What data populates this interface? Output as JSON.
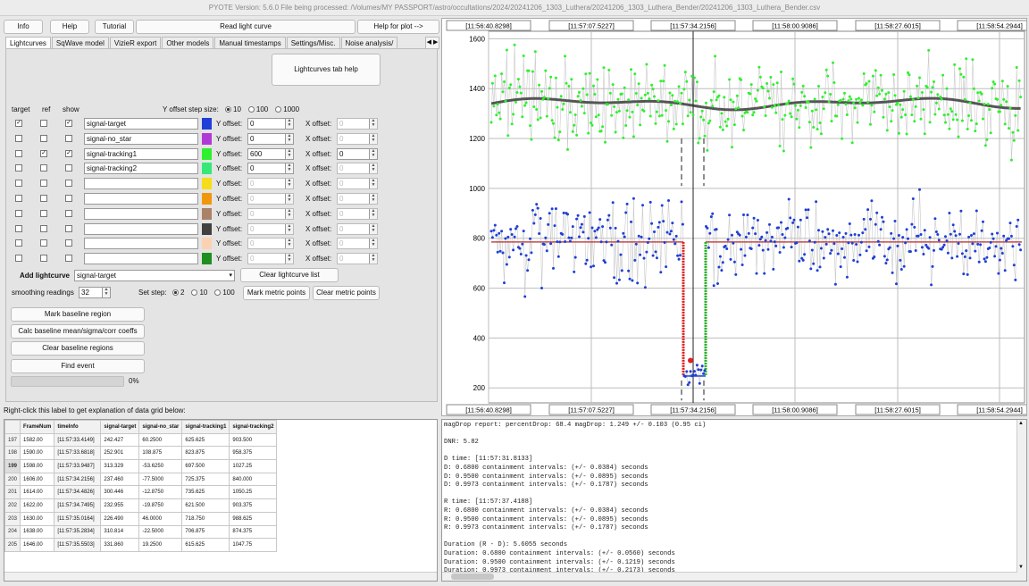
{
  "window": {
    "title": "PYOTE Version: 5.6.0  File being processed: /Volumes/MY PASSPORT/astro/occultations/2024/20241206_1303_Luthera/20241206_1303_Luthera_Bender/20241206_1303_Luthera_Bender.csv"
  },
  "toolbar": {
    "info": "Info",
    "help": "Help",
    "tutorial": "Tutorial",
    "read_light_curve": "Read light curve",
    "help_plot": "Help for plot -->"
  },
  "tabs": [
    {
      "label": "Lightcurves",
      "active": true
    },
    {
      "label": "SqWave model"
    },
    {
      "label": "VizieR export"
    },
    {
      "label": "Other models"
    },
    {
      "label": "Manual timestamps"
    },
    {
      "label": "Settings/Misc."
    },
    {
      "label": "Noise analysis/"
    }
  ],
  "lc_tab_help": "Lightcurves tab help",
  "col_headers": {
    "target": "target",
    "ref": "ref",
    "show": "show"
  },
  "y_offset_step": {
    "label": "Y offset step size:",
    "options": [
      "10",
      "100",
      "1000"
    ],
    "selected": "10"
  },
  "y_offset_label": "Y offset:",
  "x_offset_label": "X offset:",
  "curves": [
    {
      "name": "signal-target",
      "target": true,
      "ref": false,
      "show": true,
      "color": "#1f3fd6",
      "yoff": "0",
      "xoff": "0",
      "enabled": true,
      "xoff_enabled": false
    },
    {
      "name": "signal-no_star",
      "target": false,
      "ref": false,
      "show": false,
      "color": "#b03ad6",
      "yoff": "0",
      "xoff": "0",
      "enabled": true,
      "xoff_enabled": false
    },
    {
      "name": "signal-tracking1",
      "target": false,
      "ref": true,
      "show": true,
      "color": "#2ff02f",
      "yoff": "600",
      "xoff": "0",
      "enabled": true,
      "xoff_enabled": true
    },
    {
      "name": "signal-tracking2",
      "target": false,
      "ref": false,
      "show": false,
      "color": "#37e878",
      "yoff": "0",
      "xoff": "0",
      "enabled": true,
      "xoff_enabled": false
    },
    {
      "name": "",
      "target": false,
      "ref": false,
      "show": false,
      "color": "#f5dd1a",
      "yoff": "0",
      "xoff": "0",
      "enabled": false,
      "xoff_enabled": false
    },
    {
      "name": "",
      "target": false,
      "ref": false,
      "show": false,
      "color": "#f0970c",
      "yoff": "0",
      "xoff": "0",
      "enabled": false,
      "xoff_enabled": false
    },
    {
      "name": "",
      "target": false,
      "ref": false,
      "show": false,
      "color": "#a98268",
      "yoff": "0",
      "xoff": "0",
      "enabled": false,
      "xoff_enabled": false
    },
    {
      "name": "",
      "target": false,
      "ref": false,
      "show": false,
      "color": "#404040",
      "yoff": "0",
      "xoff": "0",
      "enabled": false,
      "xoff_enabled": false
    },
    {
      "name": "",
      "target": false,
      "ref": false,
      "show": false,
      "color": "#fbd2b0",
      "yoff": "0",
      "xoff": "0",
      "enabled": false,
      "xoff_enabled": false
    },
    {
      "name": "",
      "target": false,
      "ref": false,
      "show": false,
      "color": "#1f8f1f",
      "yoff": "0",
      "xoff": "0",
      "enabled": false,
      "xoff_enabled": false
    }
  ],
  "add_lightcurve": {
    "label": "Add lightcurve",
    "value": "signal-target"
  },
  "clear_list": "Clear lightcurve list",
  "smoothing": {
    "label": "smoothing readings",
    "value": "32"
  },
  "set_step": {
    "label": "Set step:",
    "options": [
      "2",
      "10",
      "100"
    ],
    "selected": "2"
  },
  "mark_metric": "Mark metric points",
  "clear_metric": "Clear metric points",
  "buttons": {
    "mark_baseline": "Mark baseline region",
    "calc_baseline": "Calc baseline mean/sigma/corr coeffs",
    "clear_baseline": "Clear baseline regions",
    "find_event": "Find event"
  },
  "progress": {
    "value": 0,
    "label": "0%"
  },
  "grid_label": "Right-click this label to get explanation of data grid below:",
  "grid": {
    "headers": [
      "",
      "FrameNum",
      "timeInfo",
      "signal-target",
      "signal-no_star",
      "signal-tracking1",
      "signal-tracking2"
    ],
    "selected_row": "199",
    "rows": [
      [
        "197",
        "1582.00",
        "[11:57:33.4149]",
        "242.427",
        "60.2500",
        "625.625",
        "903.500"
      ],
      [
        "198",
        "1590.00",
        "[11:57:33.6818]",
        "252.901",
        "108.875",
        "823.875",
        "958.375"
      ],
      [
        "199",
        "1598.00",
        "[11:57:33.9487]",
        "313.329",
        "-53.6250",
        "697.500",
        "1027.25"
      ],
      [
        "200",
        "1606.00",
        "[11:57:34.2156]",
        "237.460",
        "-77.5000",
        "725.375",
        "840.000"
      ],
      [
        "201",
        "1614.00",
        "[11:57:34.4826]",
        "300.446",
        "-12.8750",
        "735.625",
        "1050.25"
      ],
      [
        "202",
        "1622.00",
        "[11:57:34.7495]",
        "232.955",
        "-19.8750",
        "621.500",
        "903.375"
      ],
      [
        "203",
        "1630.00",
        "[11:57:35.0164]",
        "226.490",
        "46.0000",
        "718.750",
        "988.625"
      ],
      [
        "204",
        "1638.00",
        "[11:57:35.2834]",
        "310.814",
        "-22.5000",
        "706.875",
        "874.375"
      ],
      [
        "205",
        "1646.00",
        "[11:57:35.5503]",
        "331.860",
        "19.2500",
        "615.625",
        "1047.75"
      ]
    ]
  },
  "report": [
    "magDrop report: percentDrop: 68.4 magDrop: 1.249 +/- 0.103 (0.95 ci)",
    "",
    "DNR: 5.82",
    "",
    "D time: [11:57:31.8133]",
    "D: 0.6800 containment intervals: (+/- 0.0384) seconds",
    "D: 0.9500 containment intervals: (+/- 0.0895) seconds",
    "D: 0.9973 containment intervals: (+/- 0.1787) seconds",
    "",
    "R time: [11:57:37.4188]",
    "R: 0.6800 containment intervals: (+/- 0.0384) seconds",
    "R: 0.9500 containment intervals: (+/- 0.0895) seconds",
    "R: 0.9973 containment intervals: (+/- 0.1787) seconds",
    "",
    "Duration (R - D): 5.6055 seconds",
    "Duration: 0.6800 containment intervals: (+/- 0.0560) seconds",
    "Duration: 0.9500 containment intervals: (+/- 0.1219) seconds",
    "Duration: 0.9973 containment intervals: (+/- 0.2173) seconds"
  ],
  "chart_data": {
    "type": "scatter",
    "x_ticks": [
      "[11:56:40.8298]",
      "[11:57:07.5227]",
      "[11:57:34.2156]",
      "[11:58:00.9086]",
      "[11:58:27.6015]",
      "[11:58:54.2944]"
    ],
    "ylim": [
      140,
      1630
    ],
    "y_ticks": [
      200,
      400,
      600,
      800,
      1000,
      1200,
      1400,
      1600
    ],
    "grid": true,
    "event": {
      "D_time": "[11:57:31.8133]",
      "R_time": "[11:57:37.4188]",
      "cursor_time": "[11:57:34.2156]"
    },
    "series": [
      {
        "name": "signal-tracking1",
        "color": "#2ff02f",
        "baseline": 1340,
        "spread": 85
      },
      {
        "name": "signal-target",
        "color": "#1f3fd6",
        "baseline": 785,
        "event_level": 248,
        "spread": 75
      }
    ],
    "colors": {
      "smooth": "#555555",
      "baseline_fit": "#c24a4a",
      "d_marker": "#e02020",
      "r_marker": "#20b020"
    }
  }
}
